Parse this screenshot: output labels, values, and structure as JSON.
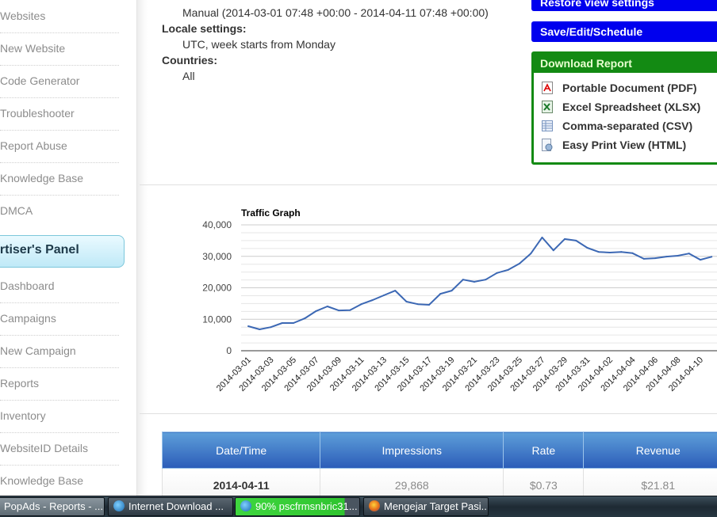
{
  "sidebar": {
    "publisher_items": [
      {
        "label": "Websites"
      },
      {
        "label": "New Website"
      },
      {
        "label": "Code Generator"
      },
      {
        "label": "Troubleshooter"
      },
      {
        "label": "Report Abuse"
      },
      {
        "label": "Knowledge Base"
      },
      {
        "label": "DMCA"
      }
    ],
    "panel_title": "ertiser's Panel",
    "advertiser_items": [
      {
        "label": "Dashboard"
      },
      {
        "label": "Campaigns"
      },
      {
        "label": "New Campaign"
      },
      {
        "label": "Reports"
      },
      {
        "label": "Inventory"
      },
      {
        "label": "WebsiteID Details"
      },
      {
        "label": "Knowledge Base"
      }
    ]
  },
  "report_info": {
    "date_range_value": "Manual (2014-03-01 07:48 +00:00 - 2014-04-11 07:48 +00:00)",
    "locale_label": "Locale settings:",
    "locale_value": "UTC, week starts from Monday",
    "countries_label": "Countries:",
    "countries_value": "All"
  },
  "actions": {
    "restore_label": "Restore view settings",
    "save_label": "Save/Edit/Schedule",
    "colors": {
      "button_blue": "#0000ee",
      "download_green": "#138a13"
    }
  },
  "download": {
    "title": "Download Report",
    "items": [
      {
        "label": "Portable Document (PDF)",
        "icon": "pdf-icon"
      },
      {
        "label": "Excel Spreadsheet (XLSX)",
        "icon": "excel-icon"
      },
      {
        "label": "Comma-separated (CSV)",
        "icon": "csv-icon"
      },
      {
        "label": "Easy Print View (HTML)",
        "icon": "print-icon"
      }
    ]
  },
  "chart_data": {
    "type": "line",
    "title": "Traffic Graph",
    "xlabel": "",
    "ylabel": "",
    "ylim": [
      0,
      40000
    ],
    "yticks": [
      0,
      10000,
      20000,
      30000,
      40000
    ],
    "ytick_labels": [
      "0",
      "10,000",
      "20,000",
      "30,000",
      "40,000"
    ],
    "minor_grid_step": 2500,
    "grid": true,
    "line_color": "#3c68b4",
    "xtick_labels": [
      "2014-03-01",
      "2014-03-03",
      "2014-03-05",
      "2014-03-07",
      "2014-03-09",
      "2014-03-11",
      "2014-03-13",
      "2014-03-15",
      "2014-03-17",
      "2014-03-19",
      "2014-03-21",
      "2014-03-23",
      "2014-03-25",
      "2014-03-27",
      "2014-03-29",
      "2014-03-31",
      "2014-04-02",
      "2014-04-04",
      "2014-04-06",
      "2014-04-08",
      "2014-04-10"
    ],
    "x": [
      "2014-03-01",
      "2014-03-02",
      "2014-03-03",
      "2014-03-04",
      "2014-03-05",
      "2014-03-06",
      "2014-03-07",
      "2014-03-08",
      "2014-03-09",
      "2014-03-10",
      "2014-03-11",
      "2014-03-12",
      "2014-03-13",
      "2014-03-14",
      "2014-03-15",
      "2014-03-16",
      "2014-03-17",
      "2014-03-18",
      "2014-03-19",
      "2014-03-20",
      "2014-03-21",
      "2014-03-22",
      "2014-03-23",
      "2014-03-24",
      "2014-03-25",
      "2014-03-26",
      "2014-03-27",
      "2014-03-28",
      "2014-03-29",
      "2014-03-30",
      "2014-03-31",
      "2014-04-01",
      "2014-04-02",
      "2014-04-03",
      "2014-04-04",
      "2014-04-05",
      "2014-04-06",
      "2014-04-07",
      "2014-04-08",
      "2014-04-09",
      "2014-04-10",
      "2014-04-11"
    ],
    "series": [
      {
        "name": "Impressions",
        "values": [
          7800,
          6800,
          7500,
          8800,
          8800,
          10300,
          12600,
          14100,
          12800,
          12900,
          14800,
          16100,
          17600,
          19100,
          15600,
          14800,
          14600,
          18100,
          19100,
          22600,
          21900,
          22600,
          24700,
          25700,
          27700,
          30900,
          36000,
          31900,
          35500,
          35000,
          32700,
          31400,
          31200,
          31400,
          31000,
          29200,
          29400,
          29900,
          30200,
          30900,
          28900,
          29868
        ]
      }
    ]
  },
  "table": {
    "columns": [
      "Date/Time",
      "Impressions",
      "Rate",
      "Revenue"
    ],
    "rows": [
      {
        "date": "2014-04-11",
        "impressions": "29,868",
        "rate": "$0.73",
        "revenue": "$21.81"
      }
    ]
  },
  "taskbar": {
    "items": [
      {
        "label": "PopAds - Reports - ..."
      },
      {
        "label": "Internet Download ..."
      },
      {
        "label": "90% pscfrmsnbric31..."
      },
      {
        "label": "Mengejar Target Pasi..."
      }
    ]
  }
}
